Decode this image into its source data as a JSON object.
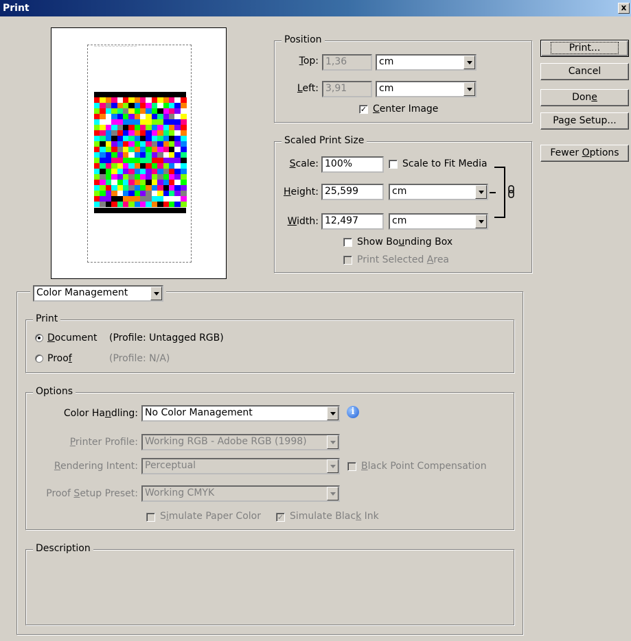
{
  "window": {
    "title": "Print",
    "close_symbol": "x"
  },
  "buttons": {
    "print": "Print...",
    "cancel": "Cancel",
    "done": "Done",
    "page_setup": "Page Setup...",
    "fewer_options": "Fewer Options"
  },
  "position": {
    "legend": "Position",
    "top_label": "Top:",
    "top_value": "1,36",
    "top_unit": "cm",
    "left_label": "Left:",
    "left_value": "3,91",
    "left_unit": "cm",
    "center_image_label": "Center Image",
    "center_image_checked": true
  },
  "scaled": {
    "legend": "Scaled Print Size",
    "scale_label": "Scale:",
    "scale_value": "100%",
    "scale_to_fit_label": "Scale to Fit Media",
    "height_label": "Height:",
    "height_value": "25,599",
    "height_unit": "cm",
    "width_label": "Width:",
    "width_value": "12,497",
    "width_unit": "cm",
    "show_bbox_label": "Show Bounding Box",
    "print_selected_label": "Print Selected Area"
  },
  "section_select": "Color Management",
  "print_group": {
    "legend": "Print",
    "document_label": "Document",
    "document_profile": "(Profile: Untagged RGB)",
    "proof_label": "Proof",
    "proof_profile": "(Profile: N/A)"
  },
  "options": {
    "legend": "Options",
    "color_handling_label": "Color Handling:",
    "color_handling_value": "No Color Management",
    "printer_profile_label": "Printer Profile:",
    "printer_profile_value": "Working RGB - Adobe RGB (1998)",
    "rendering_intent_label": "Rendering Intent:",
    "rendering_intent_value": "Perceptual",
    "black_point_label": "Black Point Compensation",
    "proof_preset_label": "Proof Setup Preset:",
    "proof_preset_value": "Working CMYK",
    "simulate_paper_label": "Simulate Paper Color",
    "simulate_black_label": "Simulate Black Ink"
  },
  "description": {
    "legend": "Description"
  },
  "icons": [
    "close-icon",
    "info-icon",
    "link-chain-icon",
    "dropdown-arrow-icon"
  ],
  "preview_colors": [
    "#ff0000",
    "#00ff00",
    "#0000ff",
    "#ffff00",
    "#ff00ff",
    "#00ffff",
    "#ff8000",
    "#8000ff",
    "#00ff80",
    "#ff0080",
    "#80ff00",
    "#0080ff",
    "#ffffff",
    "#808080",
    "#000000"
  ]
}
